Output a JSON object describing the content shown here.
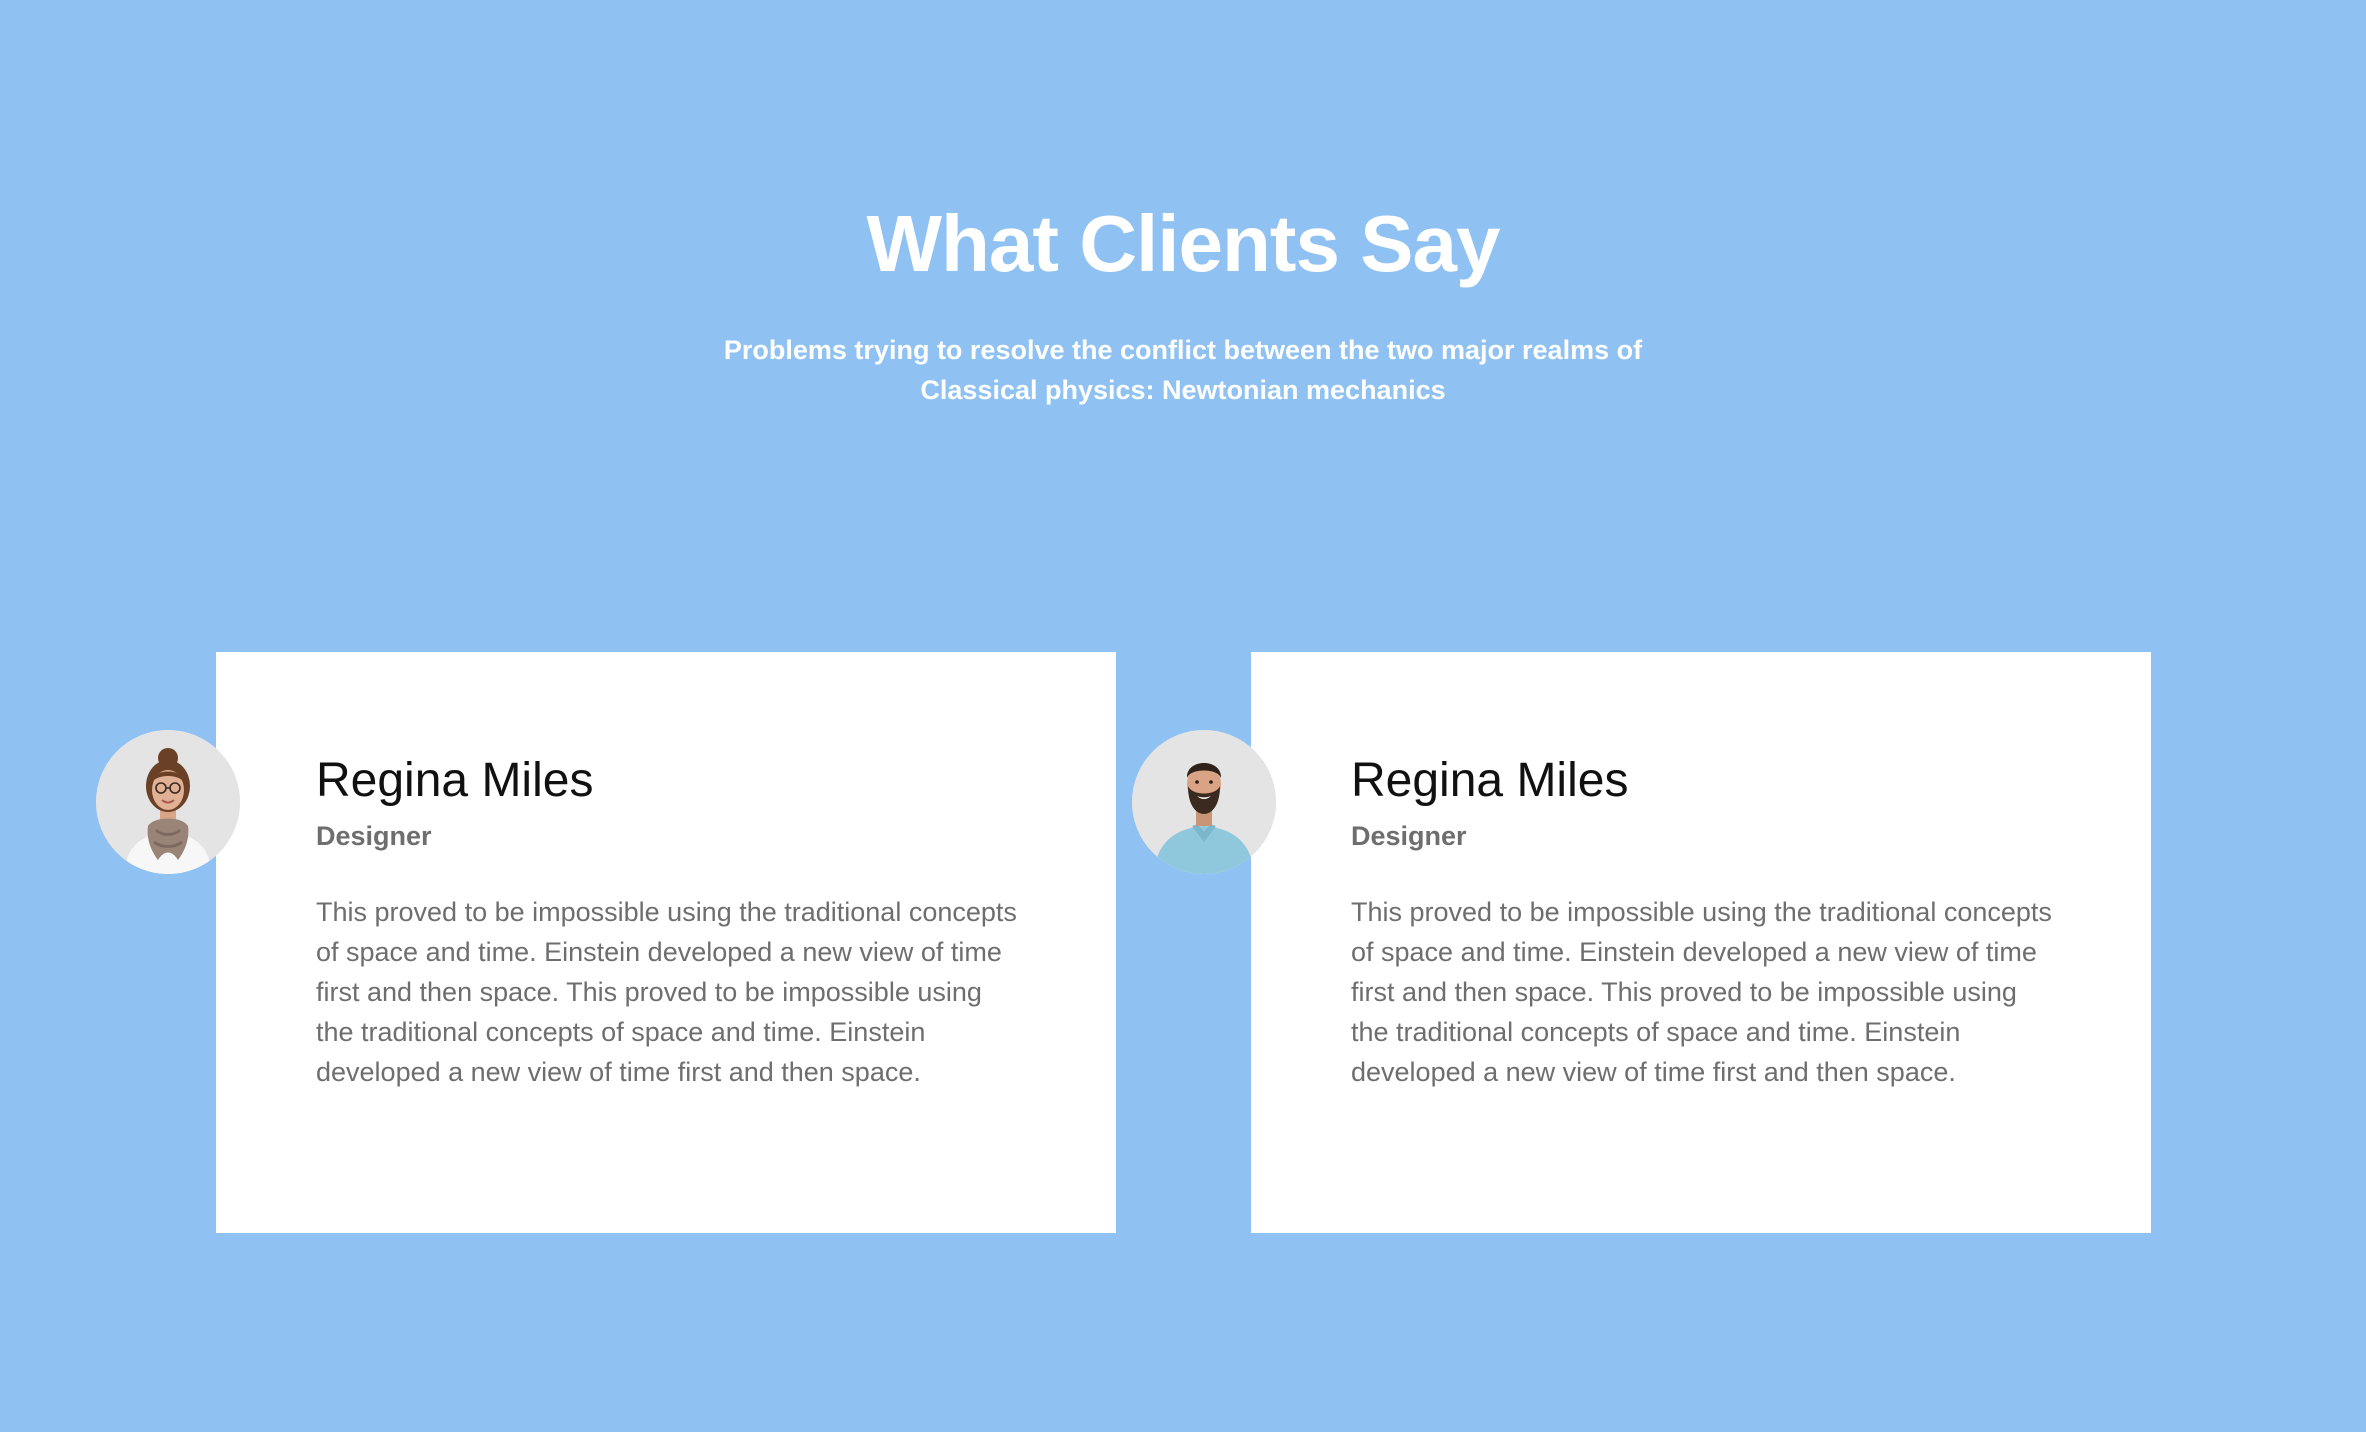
{
  "section": {
    "title": "What Clients Say",
    "subtitle_line1": "Problems trying to resolve the conflict between the two major realms of",
    "subtitle_line2": "Classical physics: Newtonian mechanics"
  },
  "testimonials": [
    {
      "name": "Regina Miles",
      "role": "Designer",
      "text": "This proved to be impossible using the traditional concepts of space and time. Einstein developed a new view of time first and then space. This proved to be impossible using the traditional concepts of space and time. Einstein developed a new view of time first and then space.",
      "avatar": "woman-portrait"
    },
    {
      "name": "Regina Miles",
      "role": "Designer",
      "text": "This proved to be impossible using the traditional concepts of space and time. Einstein developed a new view of time first and then space. This proved to be impossible using the traditional concepts of space and time. Einstein developed a new view of time first and then space.",
      "avatar": "man-portrait"
    }
  ],
  "colors": {
    "background": "#8fc2f2",
    "card": "#ffffff",
    "heading": "#ffffff",
    "name": "#111111",
    "muted_text": "#6e6e6e"
  }
}
